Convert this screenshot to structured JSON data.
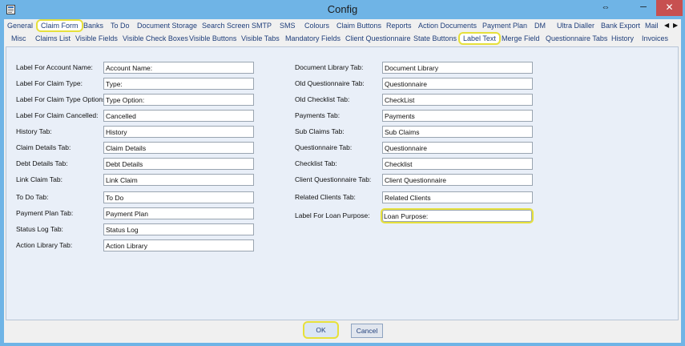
{
  "window": {
    "title": "Config",
    "resize_glyph": "⇔",
    "minimize_glyph": "─",
    "maximize_glyph": "",
    "close_glyph": "✕"
  },
  "tabs_row1": [
    "General",
    "Claim Form",
    "Banks",
    "To Do",
    "Document Storage",
    "Search Screen",
    "SMTP",
    "SMS",
    "Colours",
    "Claim Buttons",
    "Reports",
    "Action Documents",
    "Payment Plan",
    "DM",
    "Ultra Dialler",
    "Bank Export",
    "Mail"
  ],
  "tabs_row2": [
    "Misc",
    "Claims List",
    "Visible Fields",
    "Visible Check Boxes",
    "Visible Buttons",
    "Visible Tabs",
    "Mandatory Fields",
    "Client Questionnaire",
    "State Buttons",
    "Label Text",
    "Merge Field",
    "Questionnaire Tabs",
    "History",
    "Invoices"
  ],
  "active_tab_row1": "Claim Form",
  "active_tab_row2": "Label Text",
  "left_fields": [
    {
      "label": "Label For Account Name:",
      "value": "Account Name:"
    },
    {
      "label": "Label For Claim Type:",
      "value": "Type:"
    },
    {
      "label": "Label For Claim Type Options:",
      "value": "Type Option:"
    },
    {
      "label": "Label For Claim Cancelled:",
      "value": "Cancelled"
    },
    {
      "label": "History Tab:",
      "value": "History"
    },
    {
      "label": "Claim Details Tab:",
      "value": "Claim Details"
    },
    {
      "label": "Debt Details Tab:",
      "value": "Debt Details"
    },
    {
      "label": "Link Claim Tab:",
      "value": "Link Claim"
    },
    {
      "label": "To Do Tab:",
      "value": "To Do"
    },
    {
      "label": "Payment Plan Tab:",
      "value": "Payment Plan"
    },
    {
      "label": "Status Log Tab:",
      "value": "Status Log"
    },
    {
      "label": "Action Library Tab:",
      "value": "Action Library"
    }
  ],
  "right_fields": [
    {
      "label": "Document Library Tab:",
      "value": "Document Library"
    },
    {
      "label": "Old Questionnaire Tab:",
      "value": "Questionnaire"
    },
    {
      "label": "Old Checklist Tab:",
      "value": "CheckList"
    },
    {
      "label": "Payments Tab:",
      "value": "Payments"
    },
    {
      "label": "Sub Claims Tab:",
      "value": "Sub Claims"
    },
    {
      "label": "Questionnaire Tab:",
      "value": "Questionnaire"
    },
    {
      "label": "Checklist Tab:",
      "value": "Checklist"
    },
    {
      "label": "Client Questionnaire Tab:",
      "value": "Client Questionnaire"
    },
    {
      "label": "Related Clients Tab:",
      "value": "Related Clients"
    },
    {
      "label": "Label For Loan Purpose:",
      "value": "Loan Purpose:"
    }
  ],
  "buttons": {
    "ok": "OK",
    "cancel": "Cancel"
  },
  "colors": {
    "title_bar": "#6fb4e6",
    "close_button": "#c75050",
    "highlight": "#e6e03b",
    "tab_text": "#1f3e7a",
    "panel": "#e9eff8"
  },
  "icons": {
    "app": "app-icon",
    "scroll_left": "chevron-left-icon",
    "scroll_right": "chevron-right-icon"
  },
  "scroll_left_glyph": "◀",
  "scroll_right_glyph": "▶"
}
